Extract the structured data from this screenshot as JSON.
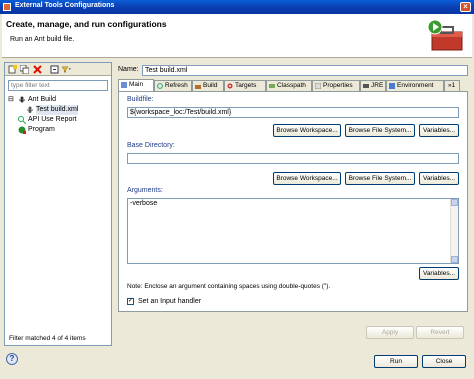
{
  "window": {
    "title": "External Tools Configurations",
    "close_glyph": "×"
  },
  "header": {
    "title": "Create, manage, and run configurations",
    "description": "Run an Ant build file."
  },
  "left": {
    "toolbar_icons": [
      "new-config-icon",
      "duplicate-icon",
      "delete-icon",
      "collapse-all-icon",
      "filter-icon"
    ],
    "filter_placeholder": "type filter text",
    "tree": [
      {
        "label": "Ant Build",
        "expander": "⊟",
        "level": 0
      },
      {
        "label": "Test build.xml",
        "level": 1,
        "selected": true
      },
      {
        "label": "API Use Report",
        "level": 0
      },
      {
        "label": "Program",
        "level": 0
      }
    ],
    "status": "Filter matched 4 of 4 items"
  },
  "right": {
    "name_label": "Name:",
    "name_value": "Test build.xml",
    "tabs": [
      "Main",
      "Refresh",
      "Build",
      "Targets",
      "Classpath",
      "Properties",
      "JRE",
      "Environment",
      "»1"
    ],
    "buildfile": {
      "label": "Buildfile:",
      "value": "${workspace_loc:/Test/build.xml}",
      "buttons": [
        "Browse Workspace...",
        "Browse File System...",
        "Variables..."
      ]
    },
    "base_directory": {
      "label": "Base Directory:",
      "value": "",
      "buttons": [
        "Browse Workspace...",
        "Browse File System...",
        "Variables..."
      ]
    },
    "arguments": {
      "label": "Arguments:",
      "value": "-verbose",
      "variables_button": "Variables..."
    },
    "note": "Note: Enclose an argument containing spaces using double-quotes (\").",
    "input_handler": {
      "label": "Set an Input handler",
      "checked": true,
      "mark": "✓"
    },
    "apply": "Apply",
    "revert": "Revert"
  },
  "footer": {
    "help_glyph": "?",
    "run": "Run",
    "close": "Close"
  },
  "colors": {
    "title_bar": "#0a3fb4",
    "accent": "#1f3c88",
    "dialog_bg": "#ece9d8"
  }
}
